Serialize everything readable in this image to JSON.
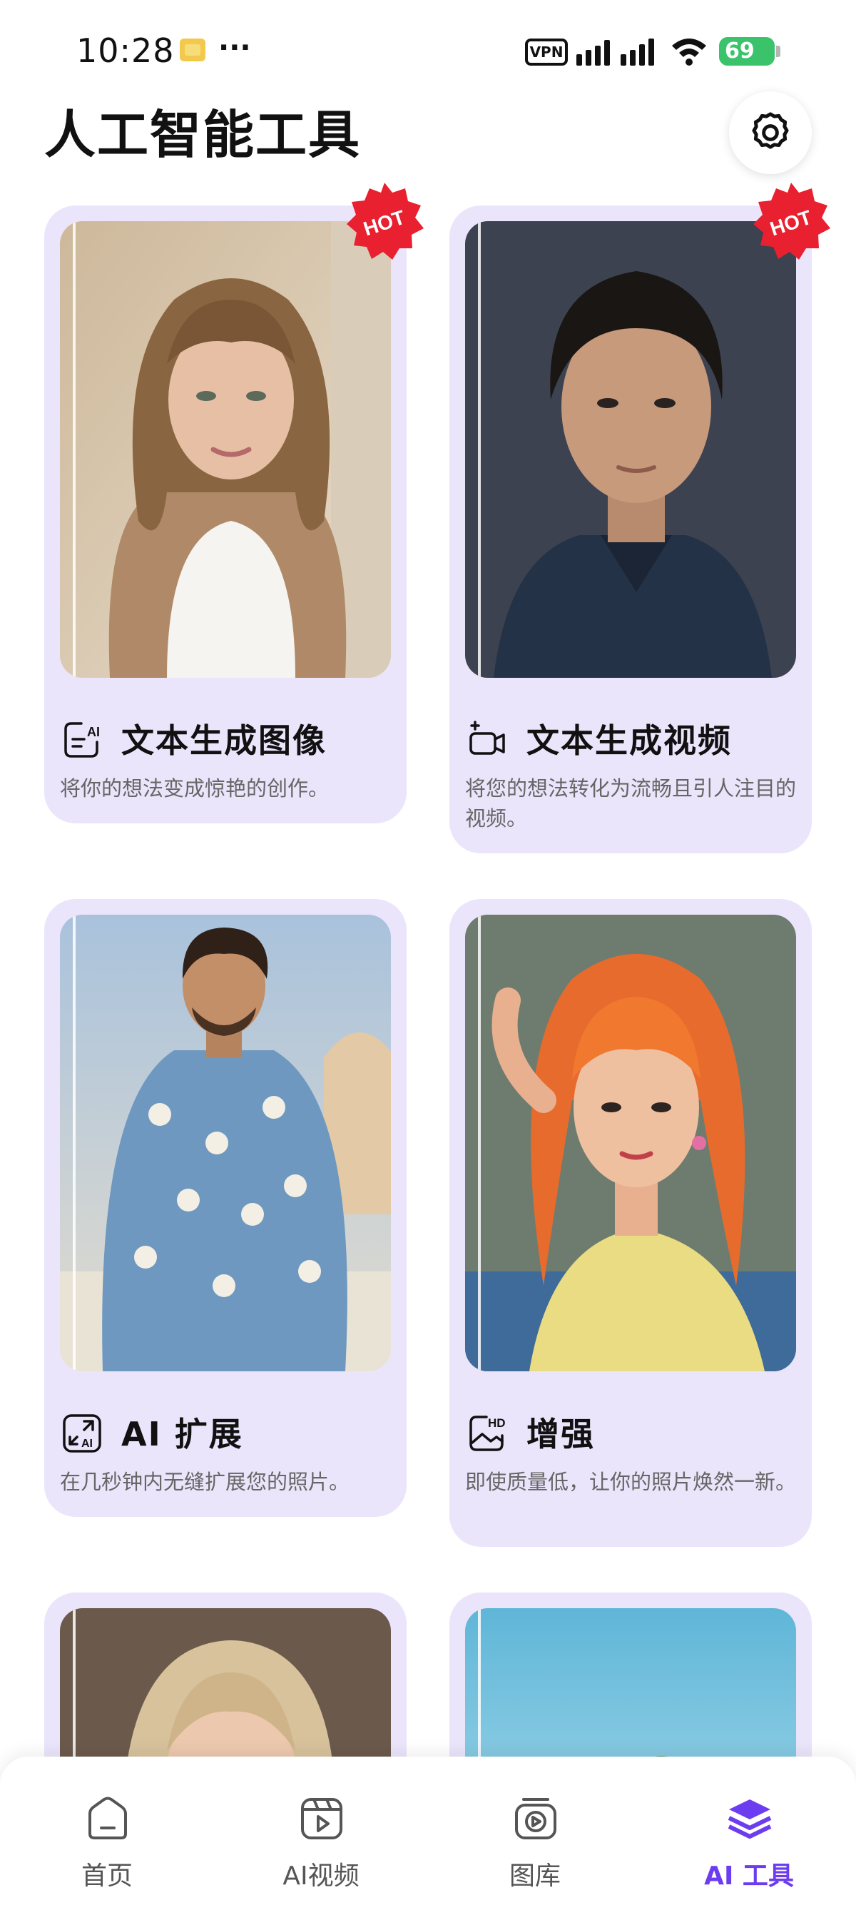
{
  "status_bar": {
    "time": "10:28",
    "dots": "···",
    "vpn": "VPN",
    "battery": "69"
  },
  "header": {
    "title": "人工智能工具"
  },
  "cards": [
    {
      "title": "文本生成图像",
      "description": "将你的想法变成惊艳的创作。",
      "icon": "text-to-image-icon",
      "badge": "HOT"
    },
    {
      "title": "文本生成视频",
      "description": "将您的想法转化为流畅且引人注目的视频。",
      "icon": "text-to-video-icon",
      "badge": "HOT"
    },
    {
      "title": "AI 扩展",
      "description": "在几秒钟内无缝扩展您的照片。",
      "icon": "ai-expand-icon"
    },
    {
      "title": "增强",
      "description": "即使质量低，让你的照片焕然一新。",
      "icon": "hd-enhance-icon"
    }
  ],
  "bottom_nav": {
    "items": [
      {
        "label": "首页",
        "icon": "home-icon",
        "active": false
      },
      {
        "label": "AI视频",
        "icon": "video-icon",
        "active": false
      },
      {
        "label": "图库",
        "icon": "gallery-icon",
        "active": false
      },
      {
        "label": "AI 工具",
        "icon": "layers-icon",
        "active": true
      }
    ]
  },
  "colors": {
    "card_bg": "#ebe5fb",
    "accent": "#6c3cf0",
    "hot_badge": "#e8202f"
  }
}
